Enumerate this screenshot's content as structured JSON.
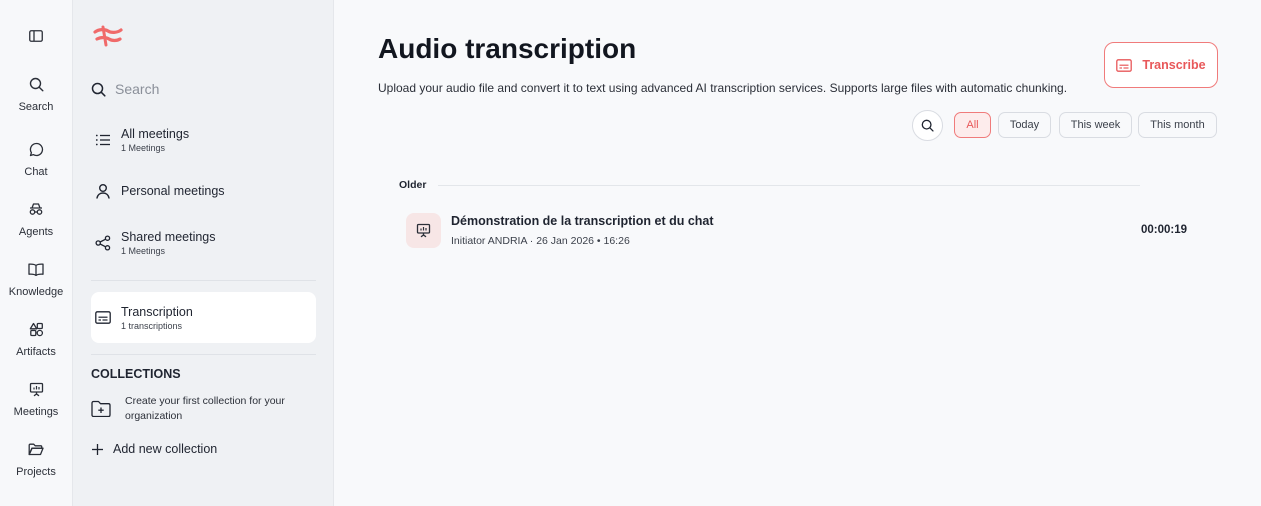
{
  "rail": {
    "items": [
      {
        "label": "Search",
        "icon": "search-icon"
      },
      {
        "label": "Chat",
        "icon": "chat-icon"
      },
      {
        "label": "Agents",
        "icon": "agents-icon"
      },
      {
        "label": "Knowledge",
        "icon": "book-icon"
      },
      {
        "label": "Artifacts",
        "icon": "shapes-icon"
      },
      {
        "label": "Meetings",
        "icon": "presentation-icon"
      },
      {
        "label": "Projects",
        "icon": "folder-icon"
      }
    ]
  },
  "sidebar": {
    "search_placeholder": "Search",
    "items": [
      {
        "label": "All meetings",
        "sub": "1 Meetings",
        "icon": "list-icon"
      },
      {
        "label": "Personal meetings",
        "sub": "",
        "icon": "user-icon"
      },
      {
        "label": "Shared meetings",
        "sub": "1 Meetings",
        "icon": "share-icon"
      },
      {
        "label": "Transcription",
        "sub": "1 transcriptions",
        "icon": "captions-icon",
        "active": true
      }
    ],
    "collections_title": "COLLECTIONS",
    "collections_empty": "Create your first collection for your organization",
    "add_collection": "Add new collection"
  },
  "main": {
    "title": "Audio transcription",
    "description": "Upload your audio file and convert it to text using advanced AI transcription services. Supports large files with automatic chunking.",
    "transcribe_button": "Transcribe",
    "filters": [
      {
        "label": "All",
        "active": true
      },
      {
        "label": "Today",
        "active": false
      },
      {
        "label": "This week",
        "active": false
      },
      {
        "label": "This month",
        "active": false
      }
    ],
    "group_label": "Older",
    "meetings": [
      {
        "title": "Démonstration de la transcription et du chat",
        "meta": "Initiator ANDRIA · 26 Jan 2026 • 16:26",
        "duration": "00:00:19"
      }
    ]
  },
  "colors": {
    "accent": "#e8585a",
    "accent_bg": "#fdecec",
    "sidebar_bg": "#eff1f4",
    "main_bg": "#f8f9fb"
  }
}
